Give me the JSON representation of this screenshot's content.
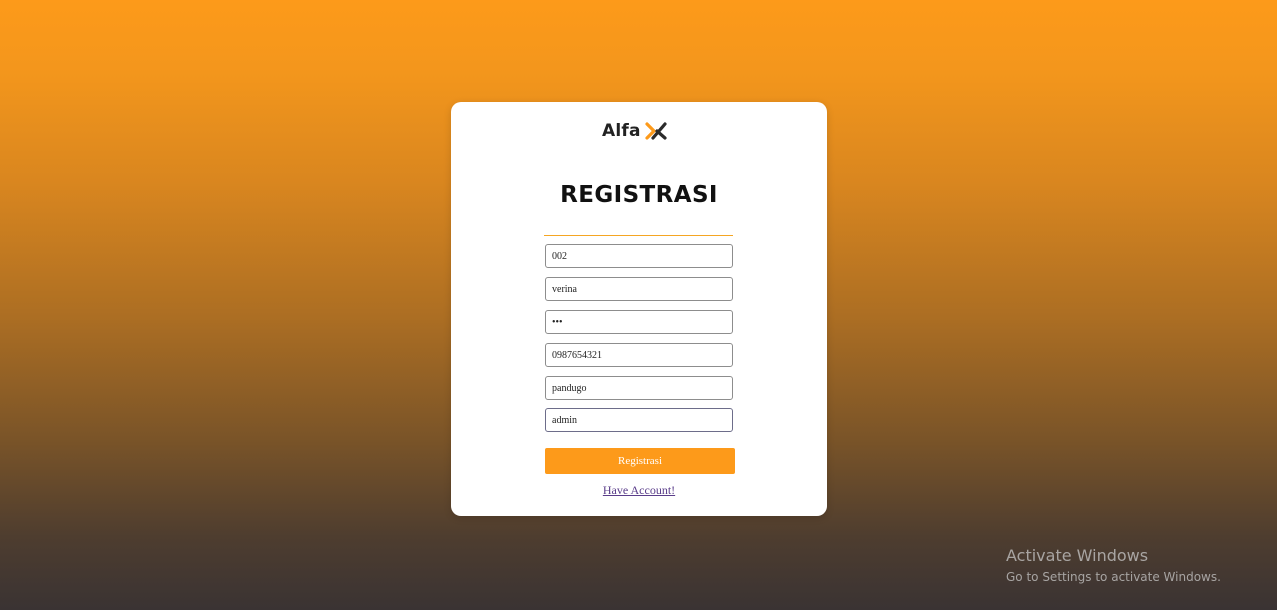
{
  "brand": {
    "name": "Alfa",
    "logo_mark_icon": "alfa-x-icon",
    "colors": {
      "accent": "#fd9a1a",
      "logo_dark": "#2b2b2b"
    }
  },
  "form": {
    "title": "REGISTRASI",
    "fields": [
      {
        "value": "002"
      },
      {
        "value": "verina"
      },
      {
        "value": "•••"
      },
      {
        "value": "0987654321"
      },
      {
        "value": "pandugo"
      },
      {
        "value": "admin"
      }
    ],
    "submit_label": "Registrasi",
    "have_account_link": "Have Account!"
  },
  "os_watermark": {
    "title": "Activate Windows",
    "subtitle": "Go to Settings to activate Windows."
  }
}
